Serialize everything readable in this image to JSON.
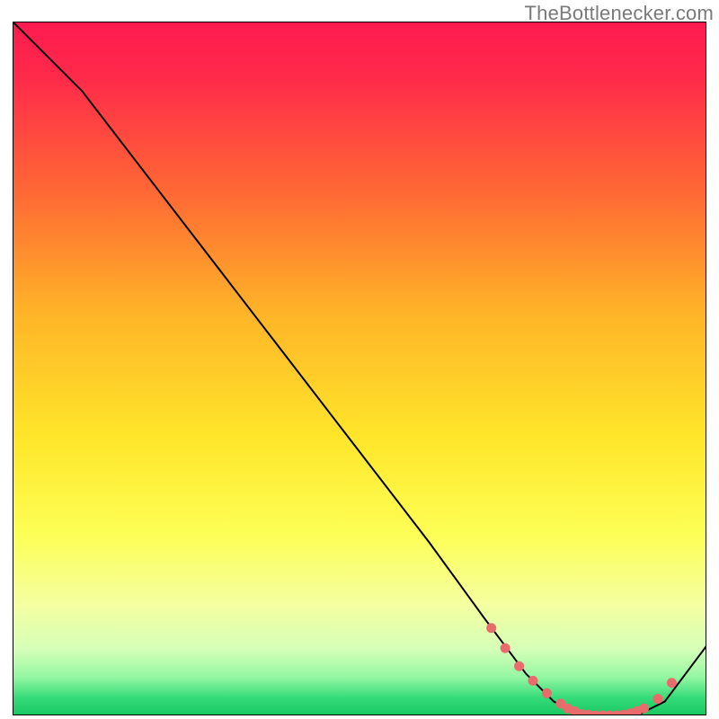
{
  "watermark": "TheBottlenecker.com",
  "colors": {
    "curve": "#000000",
    "markers_fill": "#e86c6c",
    "markers_stroke": "#e86c6c",
    "gradient_top": "#ff1a4f",
    "gradient_mid_orange": "#ff9a2a",
    "gradient_yellow": "#ffe830",
    "gradient_lightyellow": "#f7ffb0",
    "gradient_green": "#1fd36a",
    "border": "#000000"
  },
  "chart_data": {
    "type": "line",
    "title": "",
    "xlabel": "",
    "ylabel": "",
    "xlim": [
      0,
      100
    ],
    "ylim": [
      0,
      100
    ],
    "series": [
      {
        "name": "bottleneck-curve",
        "x": [
          0,
          6,
          10,
          20,
          30,
          40,
          50,
          60,
          68,
          74,
          78,
          80,
          82,
          84,
          86,
          88,
          90,
          92,
          94,
          97,
          100
        ],
        "y": [
          100,
          94,
          90,
          77,
          64,
          51,
          38,
          25,
          14,
          6,
          2,
          1,
          0,
          0,
          0,
          0,
          0,
          1,
          2,
          6,
          10
        ]
      }
    ],
    "markers": {
      "name": "highlight-dots",
      "x": [
        69,
        71,
        73,
        75,
        77,
        79,
        80,
        81,
        82,
        83,
        84,
        85,
        86,
        87,
        88,
        89,
        90,
        91,
        93,
        95
      ],
      "y": [
        12.6,
        9.7,
        7.1,
        5.0,
        3.2,
        1.7,
        1.0,
        0.6,
        0.2,
        0.1,
        0.0,
        0.0,
        0.0,
        0.0,
        0.1,
        0.3,
        0.6,
        1.0,
        2.4,
        4.7
      ]
    },
    "marker_radius": 5
  }
}
